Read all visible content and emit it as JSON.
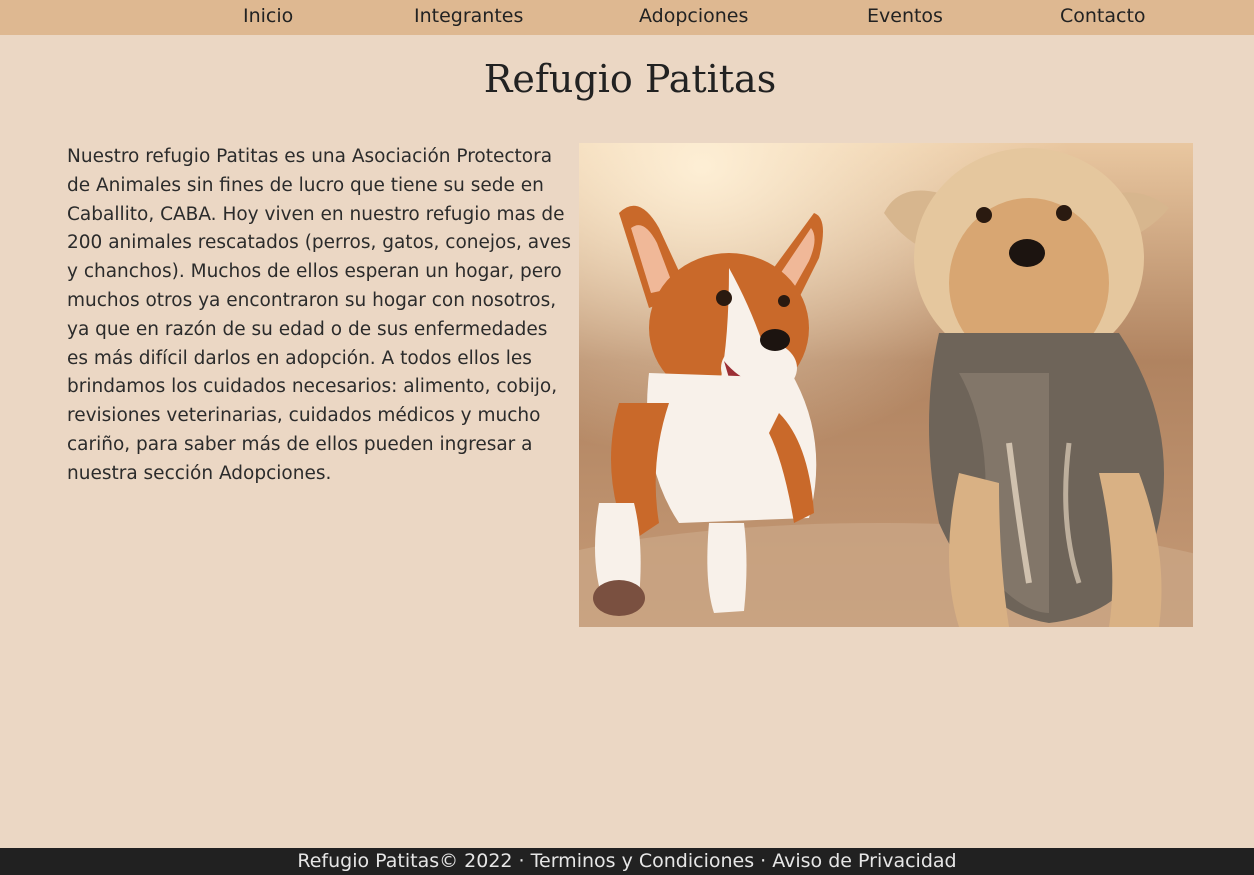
{
  "nav": {
    "items": [
      {
        "label": "Inicio"
      },
      {
        "label": "Integrantes"
      },
      {
        "label": "Adopciones"
      },
      {
        "label": "Eventos"
      },
      {
        "label": "Contacto"
      }
    ]
  },
  "main": {
    "title": "Refugio Patitas",
    "intro": "Nuestro refugio Patitas es una Asociación Protectora de Animales sin fines de lucro que tiene su sede en Caballito, CABA. Hoy viven en nuestro refugio mas de 200 animales rescatados (perros, gatos, conejos, aves y chanchos). Muchos de ellos esperan un hogar, pero muchos otros ya encontraron su hogar con nosotros, ya que en razón de su edad o de sus enfermedades es más difícil darlos en adopción. A todos ellos les brindamos los cuidados necesarios: alimento, cobijo, revisiones veterinarias, cuidados médicos y mucho cariño, para saber más de ellos pueden ingresar a nuestra sección Adopciones.",
    "photo_icon": "dogs-photo"
  },
  "footer": {
    "brand": "Refugio Patitas© 2022",
    "separator": " · ",
    "terms": "Terminos y Condiciones",
    "privacy": "Aviso de Privacidad"
  },
  "colors": {
    "background": "#ebd7c4",
    "navbar": "#deb891",
    "footer": "#212121"
  }
}
